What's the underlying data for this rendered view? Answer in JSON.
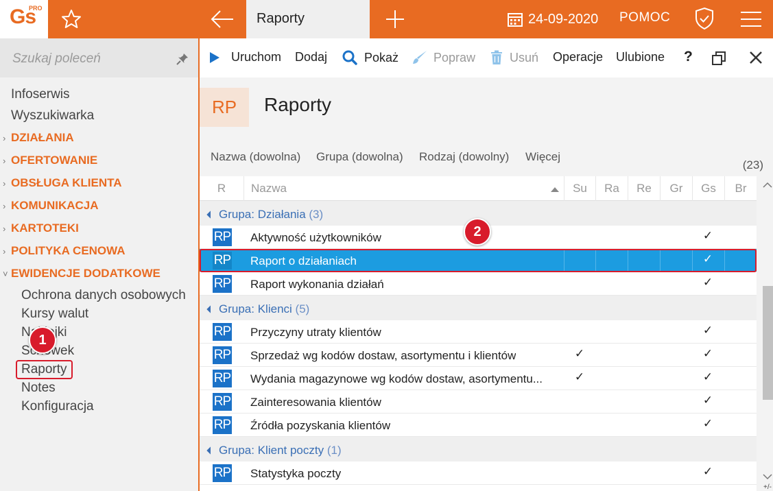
{
  "app": {
    "logo_text": "Gs",
    "logo_sup": "PRO"
  },
  "topbar": {
    "active_tab": "Raporty",
    "date": "24-09-2020",
    "help": "POMOC"
  },
  "sidebar": {
    "search_placeholder": "Szukaj poleceń",
    "top_items": [
      "Infoserwis",
      "Wyszukiwarka"
    ],
    "sections": [
      "DZIAŁANIA",
      "OFERTOWANIE",
      "OBSŁUGA KLIENTA",
      "KOMUNIKACJA",
      "KARTOTEKI",
      "POLITYKA CENOWA",
      "EWIDENCJE DODATKOWE"
    ],
    "sub_items": [
      "Ochrona danych osobowych",
      "Kursy walut",
      "Naklejki",
      "Schowek",
      "Raporty",
      "Notes",
      "Konfiguracja"
    ]
  },
  "toolbar": {
    "run": "Uruchom",
    "add": "Dodaj",
    "show": "Pokaż",
    "edit": "Popraw",
    "delete": "Usuń",
    "operations": "Operacje",
    "favorites": "Ulubione",
    "help": "?"
  },
  "page": {
    "badge": "RP",
    "title": "Raporty"
  },
  "filters": {
    "name": "Nazwa (dowolna)",
    "group": "Grupa (dowolna)",
    "kind": "Rodzaj (dowolny)",
    "more": "Więcej",
    "count": "(23)"
  },
  "grid": {
    "columns": [
      "R",
      "Nazwa",
      "Su",
      "Ra",
      "Re",
      "Gr",
      "Gs",
      "Br"
    ],
    "icon_text": "RP",
    "check": "✓",
    "group_prefix": "Grupa:",
    "groups": [
      {
        "name": "Działania",
        "count": "(3)",
        "rows": [
          {
            "name": "Aktywność użytkowników",
            "su": false,
            "gs": true
          },
          {
            "name": "Raport o działaniach",
            "su": false,
            "gs": true,
            "selected": true
          },
          {
            "name": "Raport wykonania działań",
            "su": false,
            "gs": true
          }
        ]
      },
      {
        "name": "Klienci",
        "count": "(5)",
        "rows": [
          {
            "name": "Przyczyny utraty klientów",
            "su": false,
            "gs": true
          },
          {
            "name": "Sprzedaż wg kodów dostaw, asortymentu i klientów",
            "su": true,
            "gs": true
          },
          {
            "name": "Wydania magazynowe wg kodów dostaw, asortymentu...",
            "su": true,
            "gs": true
          },
          {
            "name": "Zainteresowania klientów",
            "su": false,
            "gs": true
          },
          {
            "name": "Źródła pozyskania klientów",
            "su": false,
            "gs": true
          }
        ]
      },
      {
        "name": "Klient poczty",
        "count": "(1)",
        "rows": [
          {
            "name": "Statystyka poczty",
            "su": false,
            "gs": true
          }
        ]
      }
    ]
  },
  "callouts": [
    "1",
    "2"
  ],
  "corner": "+/-"
}
